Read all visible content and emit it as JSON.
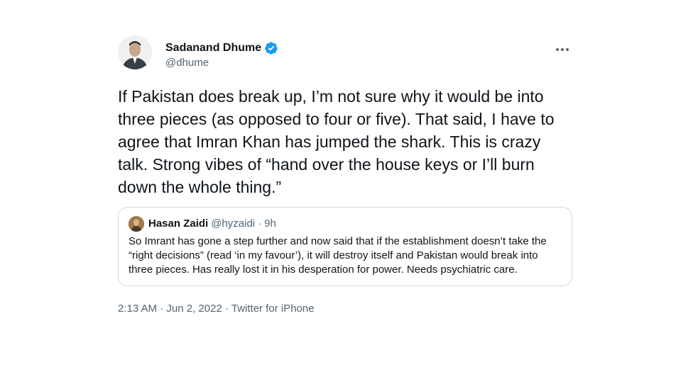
{
  "author": {
    "display_name": "Sadanand Dhume",
    "handle": "@dhume",
    "verified": true
  },
  "tweet": {
    "text": "If Pakistan does break up, I’m not sure why it would be into three pieces (as opposed to four or five). That said, I have to agree that Imran Khan has jumped the shark. This is crazy talk. Strong vibes of “hand over the house keys or I’ll burn down the whole thing.”"
  },
  "quote": {
    "display_name": "Hasan Zaidi",
    "handle": "@hyzaidi",
    "separator": "·",
    "time": "9h",
    "text": "So Imrant has gone a step further and now said that if the establishment doesn’t take the “right decisions” (read ‘in my favour’), it will destroy itself and Pakistan would break into three pieces. Has really lost it in his desperation for power. Needs psychiatric care."
  },
  "meta": {
    "time": "2:13 AM",
    "separator1": "·",
    "date": "Jun 2, 2022",
    "separator2": "·",
    "source": "Twitter for iPhone"
  },
  "colors": {
    "text": "#0f1419",
    "secondary": "#536471",
    "verified": "#1d9bf0",
    "border": "#cfd9de"
  },
  "icons": {
    "verified": "verified-badge-icon",
    "more": "more-options-icon"
  }
}
